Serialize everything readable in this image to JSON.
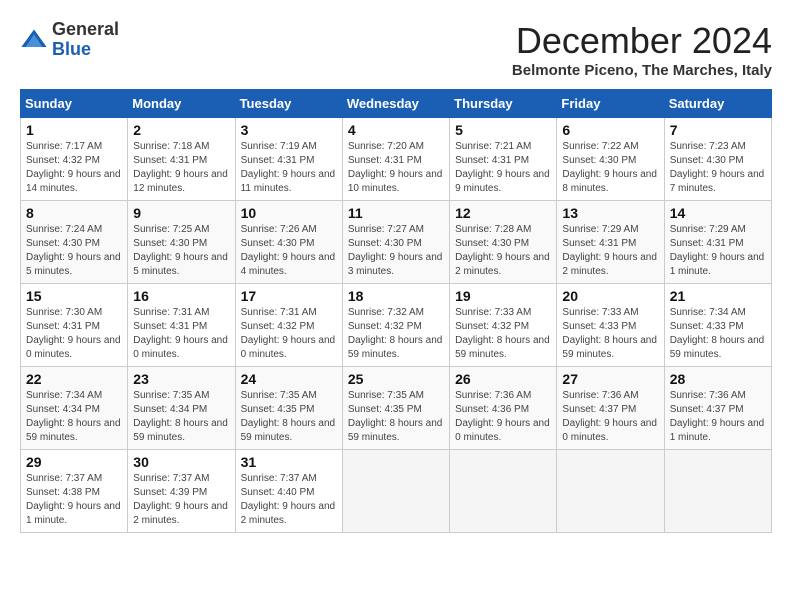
{
  "header": {
    "logo_general": "General",
    "logo_blue": "Blue",
    "month_title": "December 2024",
    "location": "Belmonte Piceno, The Marches, Italy"
  },
  "days_of_week": [
    "Sunday",
    "Monday",
    "Tuesday",
    "Wednesday",
    "Thursday",
    "Friday",
    "Saturday"
  ],
  "weeks": [
    [
      {
        "day": "1",
        "info": "Sunrise: 7:17 AM\nSunset: 4:32 PM\nDaylight: 9 hours and 14 minutes."
      },
      {
        "day": "2",
        "info": "Sunrise: 7:18 AM\nSunset: 4:31 PM\nDaylight: 9 hours and 12 minutes."
      },
      {
        "day": "3",
        "info": "Sunrise: 7:19 AM\nSunset: 4:31 PM\nDaylight: 9 hours and 11 minutes."
      },
      {
        "day": "4",
        "info": "Sunrise: 7:20 AM\nSunset: 4:31 PM\nDaylight: 9 hours and 10 minutes."
      },
      {
        "day": "5",
        "info": "Sunrise: 7:21 AM\nSunset: 4:31 PM\nDaylight: 9 hours and 9 minutes."
      },
      {
        "day": "6",
        "info": "Sunrise: 7:22 AM\nSunset: 4:30 PM\nDaylight: 9 hours and 8 minutes."
      },
      {
        "day": "7",
        "info": "Sunrise: 7:23 AM\nSunset: 4:30 PM\nDaylight: 9 hours and 7 minutes."
      }
    ],
    [
      {
        "day": "8",
        "info": "Sunrise: 7:24 AM\nSunset: 4:30 PM\nDaylight: 9 hours and 5 minutes."
      },
      {
        "day": "9",
        "info": "Sunrise: 7:25 AM\nSunset: 4:30 PM\nDaylight: 9 hours and 5 minutes."
      },
      {
        "day": "10",
        "info": "Sunrise: 7:26 AM\nSunset: 4:30 PM\nDaylight: 9 hours and 4 minutes."
      },
      {
        "day": "11",
        "info": "Sunrise: 7:27 AM\nSunset: 4:30 PM\nDaylight: 9 hours and 3 minutes."
      },
      {
        "day": "12",
        "info": "Sunrise: 7:28 AM\nSunset: 4:30 PM\nDaylight: 9 hours and 2 minutes."
      },
      {
        "day": "13",
        "info": "Sunrise: 7:29 AM\nSunset: 4:31 PM\nDaylight: 9 hours and 2 minutes."
      },
      {
        "day": "14",
        "info": "Sunrise: 7:29 AM\nSunset: 4:31 PM\nDaylight: 9 hours and 1 minute."
      }
    ],
    [
      {
        "day": "15",
        "info": "Sunrise: 7:30 AM\nSunset: 4:31 PM\nDaylight: 9 hours and 0 minutes."
      },
      {
        "day": "16",
        "info": "Sunrise: 7:31 AM\nSunset: 4:31 PM\nDaylight: 9 hours and 0 minutes."
      },
      {
        "day": "17",
        "info": "Sunrise: 7:31 AM\nSunset: 4:32 PM\nDaylight: 9 hours and 0 minutes."
      },
      {
        "day": "18",
        "info": "Sunrise: 7:32 AM\nSunset: 4:32 PM\nDaylight: 8 hours and 59 minutes."
      },
      {
        "day": "19",
        "info": "Sunrise: 7:33 AM\nSunset: 4:32 PM\nDaylight: 8 hours and 59 minutes."
      },
      {
        "day": "20",
        "info": "Sunrise: 7:33 AM\nSunset: 4:33 PM\nDaylight: 8 hours and 59 minutes."
      },
      {
        "day": "21",
        "info": "Sunrise: 7:34 AM\nSunset: 4:33 PM\nDaylight: 8 hours and 59 minutes."
      }
    ],
    [
      {
        "day": "22",
        "info": "Sunrise: 7:34 AM\nSunset: 4:34 PM\nDaylight: 8 hours and 59 minutes."
      },
      {
        "day": "23",
        "info": "Sunrise: 7:35 AM\nSunset: 4:34 PM\nDaylight: 8 hours and 59 minutes."
      },
      {
        "day": "24",
        "info": "Sunrise: 7:35 AM\nSunset: 4:35 PM\nDaylight: 8 hours and 59 minutes."
      },
      {
        "day": "25",
        "info": "Sunrise: 7:35 AM\nSunset: 4:35 PM\nDaylight: 8 hours and 59 minutes."
      },
      {
        "day": "26",
        "info": "Sunrise: 7:36 AM\nSunset: 4:36 PM\nDaylight: 9 hours and 0 minutes."
      },
      {
        "day": "27",
        "info": "Sunrise: 7:36 AM\nSunset: 4:37 PM\nDaylight: 9 hours and 0 minutes."
      },
      {
        "day": "28",
        "info": "Sunrise: 7:36 AM\nSunset: 4:37 PM\nDaylight: 9 hours and 1 minute."
      }
    ],
    [
      {
        "day": "29",
        "info": "Sunrise: 7:37 AM\nSunset: 4:38 PM\nDaylight: 9 hours and 1 minute."
      },
      {
        "day": "30",
        "info": "Sunrise: 7:37 AM\nSunset: 4:39 PM\nDaylight: 9 hours and 2 minutes."
      },
      {
        "day": "31",
        "info": "Sunrise: 7:37 AM\nSunset: 4:40 PM\nDaylight: 9 hours and 2 minutes."
      },
      null,
      null,
      null,
      null
    ]
  ]
}
